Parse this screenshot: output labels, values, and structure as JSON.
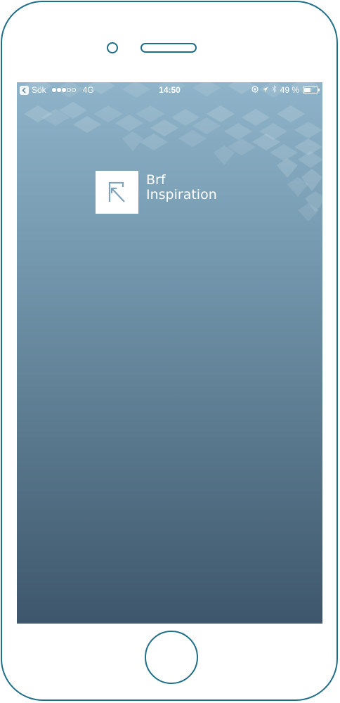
{
  "status_bar": {
    "back_label": "Sök",
    "signal_bars_filled": 3,
    "signal_bars_total": 5,
    "network": "4G",
    "time": "14:50",
    "battery": "49 %",
    "battery_level": 0.49,
    "icons": [
      "chevron-left-icon",
      "orientation-lock-icon",
      "location-arrow-icon",
      "bluetooth-icon",
      "battery-icon"
    ]
  },
  "splash": {
    "brand_line1": "Brf",
    "brand_line2": "Inspiration",
    "logo_icon": "brf-logo-icon"
  },
  "colors": {
    "frame": "#1f6f88",
    "gradient_top": "#8fb4c9",
    "gradient_bottom": "#3e566b",
    "logo_mark": "#7fa3b9"
  }
}
